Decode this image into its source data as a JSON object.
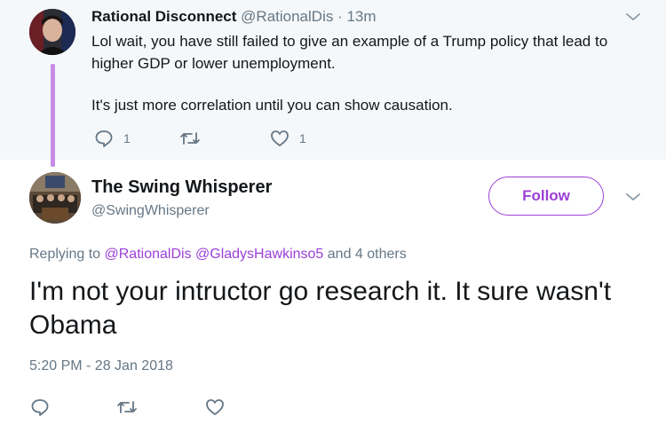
{
  "parent_tweet": {
    "display_name": "Rational Disconnect",
    "handle": "@RationalDis",
    "time": "· 13m",
    "line1": "Lol wait, you have still failed to give an example of a Trump policy that lead to higher GDP or lower unemployment.",
    "line2": "It's just more correlation until you can show causation.",
    "reply_count": "1",
    "like_count": "1"
  },
  "main_tweet": {
    "display_name": "The Swing Whisperer",
    "handle": "@SwingWhisperer",
    "follow_label": "Follow",
    "replying_prefix": "Replying to",
    "mention1": "@RationalDis",
    "mention2": "@GladysHawkinso5",
    "replying_suffix": "and 4 others",
    "text": "I'm not your intructor go research it. It sure wasn't Obama",
    "timestamp": "5:20 PM - 28 Jan 2018"
  },
  "icons": [
    "reply-icon",
    "retweet-icon",
    "like-icon",
    "chevron-down-icon"
  ],
  "colors": {
    "accent": "#9b3fd6",
    "thread_line": "#c68de6",
    "secondary_text": "#657786",
    "parent_bg": "#f5f8fa"
  }
}
